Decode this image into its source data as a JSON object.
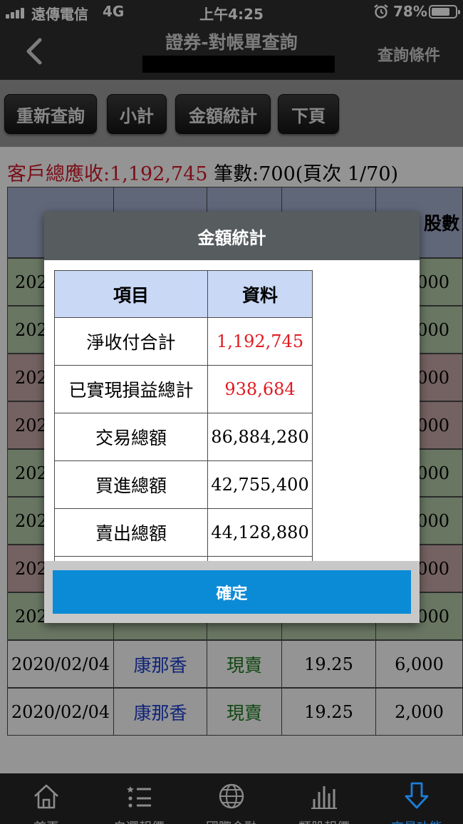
{
  "status_bar": {
    "carrier": "遠傳電信",
    "network": "4G",
    "time": "上午4:25",
    "battery_text": "78%",
    "battery_level": 0.78
  },
  "header": {
    "title": "證券-對帳單查詢",
    "right_button": "查詢條件"
  },
  "toolbar": {
    "buttons": [
      "重新查詢",
      "小計",
      "金額統計",
      "下頁"
    ]
  },
  "summary": {
    "receivable_label": "客戶總應收:",
    "receivable_value": "1,192,745",
    "count_label": "筆數:700(頁次 1/70)"
  },
  "table": {
    "visible_header_text": "股數",
    "row_dates": [
      "202",
      "202",
      "202",
      "202",
      "202",
      "202",
      "202",
      "202"
    ],
    "row_qty": [
      "000",
      "000",
      "000",
      "000",
      ",000",
      "000",
      ",000",
      "000"
    ],
    "rows": [
      {
        "date": "2020/02/04",
        "name": "康那香",
        "type": "現賣",
        "price": "19.25",
        "qty": "6,000"
      },
      {
        "date": "2020/02/04",
        "name": "康那香",
        "type": "現賣",
        "price": "19.25",
        "qty": "2,000"
      }
    ],
    "colors": {
      "green_row": "#b3ccaa",
      "red_row": "#c8a8a8",
      "white_row": "#ffffff",
      "header": "#a5b2d0"
    }
  },
  "dialog": {
    "title": "金額統計",
    "col_item": "項目",
    "col_value": "資料",
    "rows": [
      {
        "item": "淨收付合計",
        "value": "1,192,745",
        "highlight": true
      },
      {
        "item": "已實現損益總計",
        "value": "938,684",
        "highlight": true
      },
      {
        "item": "交易總額",
        "value": "86,884,280",
        "highlight": false
      },
      {
        "item": "買進總額",
        "value": "42,755,400",
        "highlight": false
      },
      {
        "item": "賣出總額",
        "value": "44,128,880",
        "highlight": false
      }
    ],
    "ok_button": "確定"
  },
  "tabbar": {
    "tabs": [
      "首頁",
      "自選報價",
      "國際金融",
      "類股報價",
      "交易功能"
    ],
    "active_index": 4
  }
}
